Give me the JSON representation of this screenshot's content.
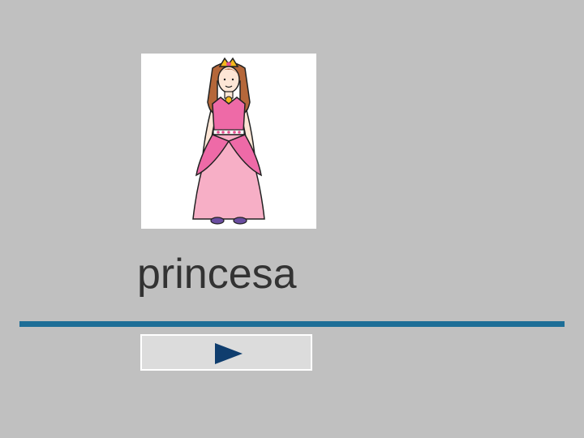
{
  "card": {
    "image": "princess-illustration",
    "word": "princesa"
  },
  "controls": {
    "next_icon": "play-triangle-icon"
  },
  "colors": {
    "background": "#c0c0c0",
    "rule": "#1d6e97",
    "button_face": "#dcdcdc",
    "icon": "#0f3d6e",
    "text": "#333333",
    "dress_pink": "#ee6aa7",
    "skirt_pink": "#f7afc6"
  }
}
